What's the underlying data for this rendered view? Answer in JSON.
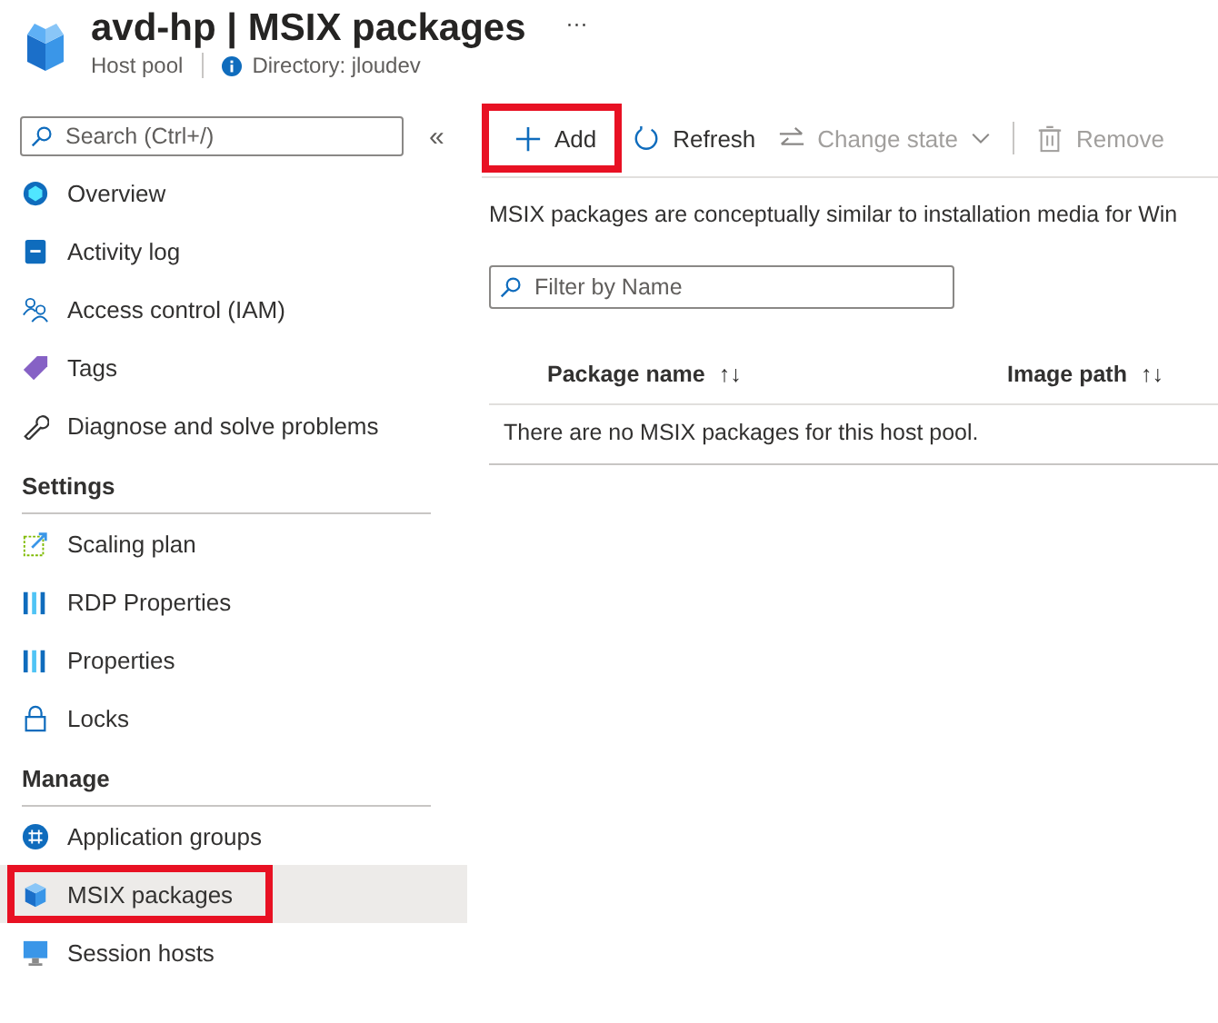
{
  "header": {
    "title": "avd-hp | MSIX packages",
    "subtitle": "Host pool",
    "directory": "Directory: jloudev",
    "more": "···"
  },
  "sidebar": {
    "search": {
      "placeholder": "Search (Ctrl+/)"
    },
    "collapse": "«",
    "sections": [
      {
        "items": [
          {
            "label": "Overview",
            "selected": false,
            "highlighted": false
          },
          {
            "label": "Activity log",
            "selected": false,
            "highlighted": false
          },
          {
            "label": "Access control (IAM)",
            "selected": false,
            "highlighted": false
          },
          {
            "label": "Tags",
            "selected": false,
            "highlighted": false
          },
          {
            "label": "Diagnose and solve problems",
            "selected": false,
            "highlighted": false
          }
        ]
      },
      {
        "heading": "Settings",
        "items": [
          {
            "label": "Scaling plan",
            "selected": false,
            "highlighted": false
          },
          {
            "label": "RDP Properties",
            "selected": false,
            "highlighted": false
          },
          {
            "label": "Properties",
            "selected": false,
            "highlighted": false
          },
          {
            "label": "Locks",
            "selected": false,
            "highlighted": false
          }
        ]
      },
      {
        "heading": "Manage",
        "items": [
          {
            "label": "Application groups",
            "selected": false,
            "highlighted": false
          },
          {
            "label": "MSIX packages",
            "selected": true,
            "highlighted": true
          },
          {
            "label": "Session hosts",
            "selected": false,
            "highlighted": false
          }
        ]
      }
    ]
  },
  "toolbar": [
    {
      "label": "Add",
      "disabled": false,
      "highlighted": true,
      "dropdown": false
    },
    {
      "label": "Refresh",
      "disabled": false,
      "highlighted": false,
      "dropdown": false
    },
    {
      "label": "Change state",
      "disabled": true,
      "highlighted": false,
      "dropdown": true
    },
    {
      "label": "Remove",
      "disabled": true,
      "highlighted": false,
      "dropdown": false
    }
  ],
  "description": "MSIX packages are conceptually similar to installation media for Win",
  "filter": {
    "placeholder": "Filter by Name"
  },
  "table": {
    "columns": [
      {
        "label": "Package name",
        "sort": "↑↓"
      },
      {
        "label": "Image path",
        "sort": "↑↓"
      }
    ],
    "empty": "There are no MSIX packages for this host pool."
  }
}
